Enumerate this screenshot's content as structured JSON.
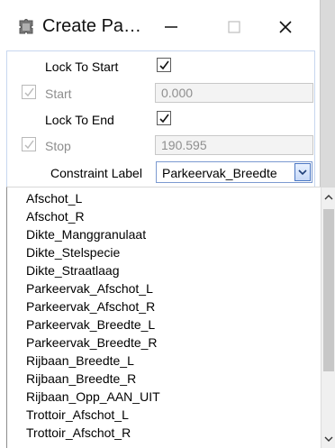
{
  "window": {
    "title": "Create Pa…"
  },
  "form": {
    "lock_to_start": {
      "label": "Lock To Start",
      "checked": true
    },
    "start": {
      "label": "Start",
      "value": "0.000"
    },
    "lock_to_end": {
      "label": "Lock To End",
      "checked": true
    },
    "stop": {
      "label": "Stop",
      "value": "190.595"
    },
    "constraint": {
      "label": "Constraint Label",
      "selected": "Parkeervak_Breedte"
    }
  },
  "dropdown": {
    "items": [
      "Afschot_L",
      "Afschot_R",
      "Dikte_Manggranulaat",
      "Dikte_Stelspecie",
      "Dikte_Straatlaag",
      "Parkeervak_Afschot_L",
      "Parkeervak_Afschot_R",
      "Parkeervak_Breedte_L",
      "Parkeervak_Breedte_R",
      "Rijbaan_Breedte_L",
      "Rijbaan_Breedte_R",
      "Rijbaan_Opp_AAN_UIT",
      "Trottoir_Afschot_L",
      "Trottoir_Afschot_R"
    ]
  },
  "icons": {
    "app": "puzzle-piece-icon",
    "minimize": "minimize-icon",
    "maximize": "maximize-icon",
    "close": "close-icon",
    "checkbox": "checkmark-icon",
    "combo": "chevron-down-icon",
    "scroll_up": "chevron-up-icon",
    "scroll_down": "chevron-down-icon"
  },
  "colors": {
    "accent": "#4b77c3",
    "disabled": "#8d8d8d",
    "field_bg": "#f3f3f3"
  }
}
